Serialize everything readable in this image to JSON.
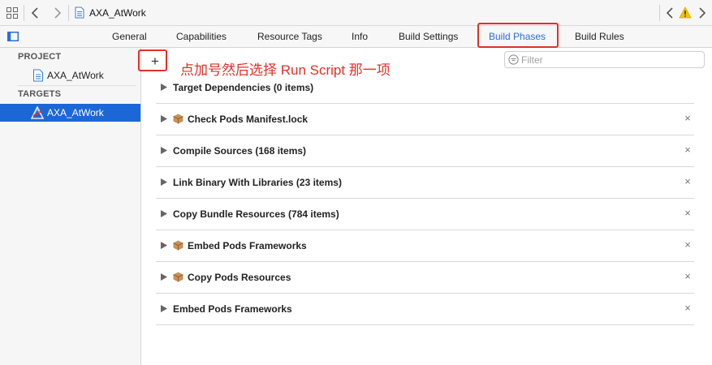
{
  "toolbar": {
    "file_title": "AXA_AtWork"
  },
  "tabs": [
    {
      "label": "General"
    },
    {
      "label": "Capabilities"
    },
    {
      "label": "Resource Tags"
    },
    {
      "label": "Info"
    },
    {
      "label": "Build Settings"
    },
    {
      "label": "Build Phases",
      "active": true
    },
    {
      "label": "Build Rules"
    }
  ],
  "sidebar": {
    "project_header": "PROJECT",
    "project_item": "AXA_AtWork",
    "targets_header": "TARGETS",
    "target_item": "AXA_AtWork"
  },
  "main": {
    "add_label": "+",
    "annotation": "点加号然后选择 Run Script 那一项",
    "filter_placeholder": "Filter",
    "close_symbol": "×",
    "phases": [
      {
        "label": "Target Dependencies (0 items)",
        "pod_icon": false,
        "closable": false
      },
      {
        "label": "Check Pods Manifest.lock",
        "pod_icon": true,
        "closable": true
      },
      {
        "label": "Compile Sources (168 items)",
        "pod_icon": false,
        "closable": true
      },
      {
        "label": "Link Binary With Libraries (23 items)",
        "pod_icon": false,
        "closable": true
      },
      {
        "label": "Copy Bundle Resources (784 items)",
        "pod_icon": false,
        "closable": true
      },
      {
        "label": "Embed Pods Frameworks",
        "pod_icon": true,
        "closable": true
      },
      {
        "label": "Copy Pods Resources",
        "pod_icon": true,
        "closable": true
      },
      {
        "label": "Embed Pods Frameworks",
        "pod_icon": false,
        "closable": true
      }
    ]
  },
  "colors": {
    "accent": "#2a6fd6",
    "selection": "#1c67d6",
    "highlight": "#e0312a",
    "warning": "#f5c400"
  },
  "icons": [
    "grid-icon",
    "back-arrow-icon",
    "forward-arrow-icon",
    "file-icon",
    "warning-icon",
    "sidebar-toggle-icon",
    "xcode-target-icon",
    "filter-icon",
    "disclosure-triangle-icon",
    "pod-box-icon",
    "close-icon"
  ]
}
